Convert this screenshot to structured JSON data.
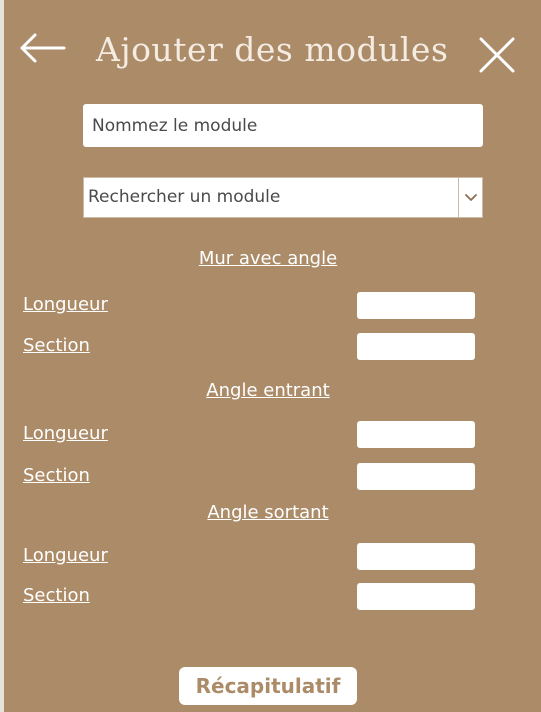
{
  "header": {
    "title": "Ajouter des modules",
    "back_icon": "arrow-left-icon",
    "close_icon": "close-icon"
  },
  "form": {
    "name_placeholder": "Nommez le module",
    "search_select_value": "Rechercher un module"
  },
  "sections": [
    {
      "title": "Mur avec angle",
      "fields": [
        {
          "label": "Longueur",
          "value": ""
        },
        {
          "label": "Section",
          "value": ""
        }
      ]
    },
    {
      "title": "Angle entrant",
      "fields": [
        {
          "label": "Longueur",
          "value": ""
        },
        {
          "label": "Section",
          "value": ""
        }
      ]
    },
    {
      "title": "Angle sortant",
      "fields": [
        {
          "label": "Longueur",
          "value": ""
        },
        {
          "label": "Section",
          "value": ""
        }
      ]
    }
  ],
  "actions": {
    "summary_label": "Récapitulatif"
  },
  "colors": {
    "background": "#ab8b68",
    "text": "#ffffff",
    "input_background": "#ffffff"
  }
}
